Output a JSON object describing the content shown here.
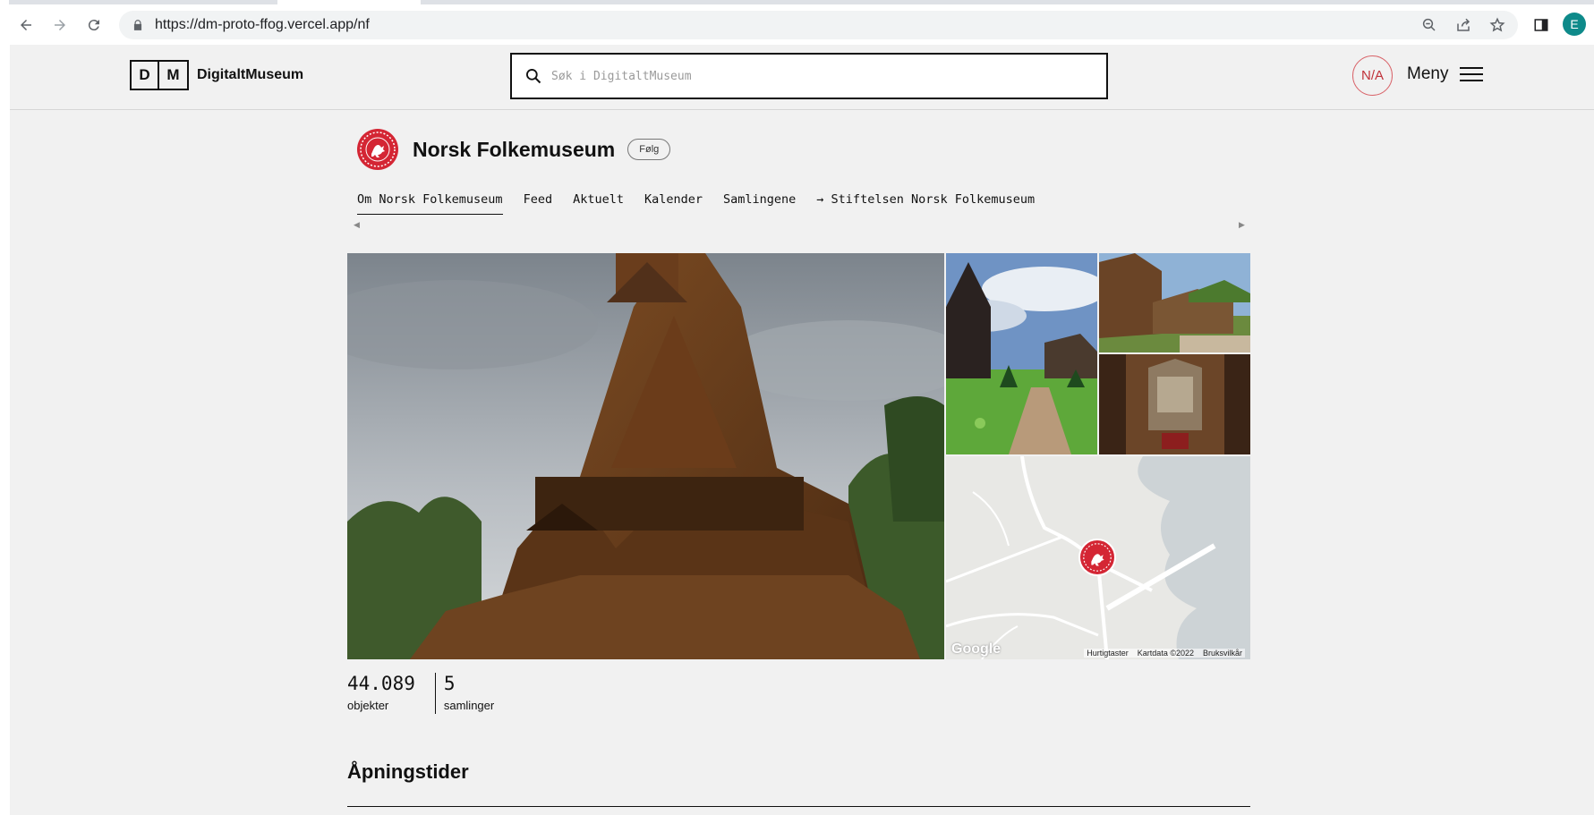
{
  "browser": {
    "url": "https://dm-proto-ffog.vercel.app/nf",
    "profile_initial": "E"
  },
  "site": {
    "logo_letters": [
      "D",
      "M"
    ],
    "logo_name": "DigitaltMuseum",
    "search_placeholder": "Søk i DigitaltMuseum",
    "user_badge": "N/A",
    "menu_label": "Meny"
  },
  "museum": {
    "title": "Norsk Folkemuseum",
    "follow_label": "Følg",
    "tabs": [
      {
        "label": "Om Norsk Folkemuseum",
        "active": true
      },
      {
        "label": "Feed",
        "active": false
      },
      {
        "label": "Aktuelt",
        "active": false
      },
      {
        "label": "Kalender",
        "active": false
      },
      {
        "label": "Samlingene",
        "active": false
      },
      {
        "label": "→ Stiftelsen Norsk Folkemuseum",
        "active": false
      }
    ]
  },
  "map": {
    "brand": "Google",
    "attribution": [
      "Hurtigtaster",
      "Kartdata ©2022",
      "Bruksvilkår"
    ]
  },
  "stats": [
    {
      "value": "44.089",
      "label": "objekter"
    },
    {
      "value": "5",
      "label": "samlinger"
    }
  ],
  "section": {
    "title": "Åpningstider"
  },
  "colors": {
    "accent_red": "#d42634",
    "page_bg": "#f1f1f1"
  }
}
